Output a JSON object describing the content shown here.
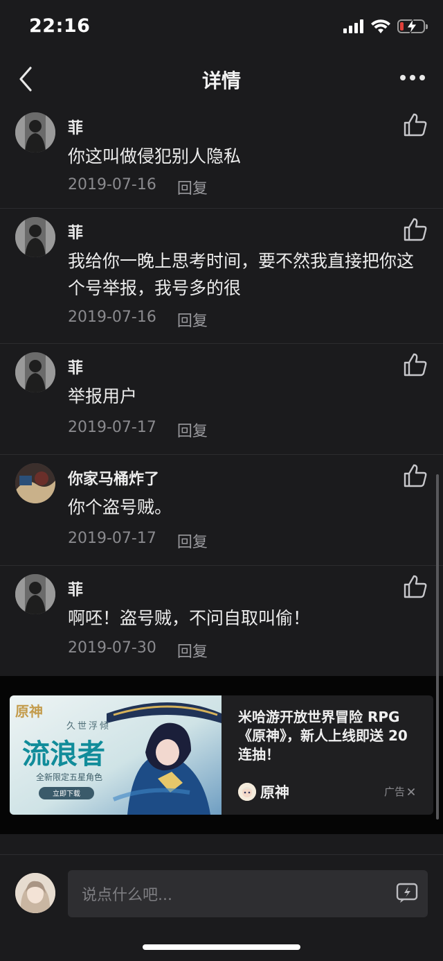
{
  "status_bar": {
    "time": "22:16"
  },
  "nav": {
    "title": "详情"
  },
  "comments": [
    {
      "user": "菲",
      "text": "你这叫做侵犯别人隐私",
      "date": "2019-07-16",
      "reply": "回复"
    },
    {
      "user": "菲",
      "text": "我给你一晚上思考时间，要不然我直接把你这个号举报，我号多的很",
      "date": "2019-07-16",
      "reply": "回复"
    },
    {
      "user": "菲",
      "text": "举报用户",
      "date": "2019-07-17",
      "reply": "回复"
    },
    {
      "user": "你家马桶炸了",
      "text": "你个盗号贼。",
      "date": "2019-07-17",
      "reply": "回复"
    },
    {
      "user": "菲",
      "text": "啊呸！盗号贼，不问自取叫偷！",
      "date": "2019-07-30",
      "reply": "回复"
    }
  ],
  "ad": {
    "image_logo": "原神",
    "image_subtitle": "久世浮倾",
    "image_headline": "流浪者",
    "image_caption": "全新限定五星角色",
    "image_button": "立即下载",
    "text": "米哈游开放世界冒险 RPG《原神》，新人上线即送 20 连抽！",
    "brand": "原神",
    "label": "广告"
  },
  "input": {
    "placeholder": "说点什么吧..."
  },
  "colors": {
    "background": "#1b1b1d",
    "ad_background": "#050505",
    "text": "#ececec",
    "meta": "#8a8a8e"
  }
}
